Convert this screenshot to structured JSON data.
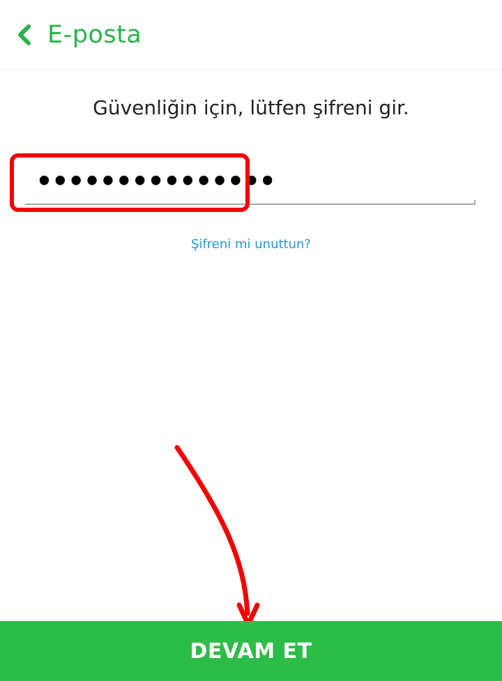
{
  "header": {
    "back_icon": "chevron-left-icon",
    "title": "E-posta"
  },
  "main": {
    "prompt": "Güvenliğin için, lütfen şifreni gir.",
    "password_value": "•••••••••••••••",
    "forgot_link": "Şifreni mi unuttun?"
  },
  "footer": {
    "continue_label": "DEVAM ET"
  },
  "colors": {
    "accent_green": "#2ab24b",
    "button_green": "#2cbd48",
    "link_blue": "#1e9bd0",
    "annotation_red": "#f40000"
  },
  "annotations": {
    "highlight_icon": "red-outline-box",
    "arrow_icon": "red-arrow-down"
  }
}
